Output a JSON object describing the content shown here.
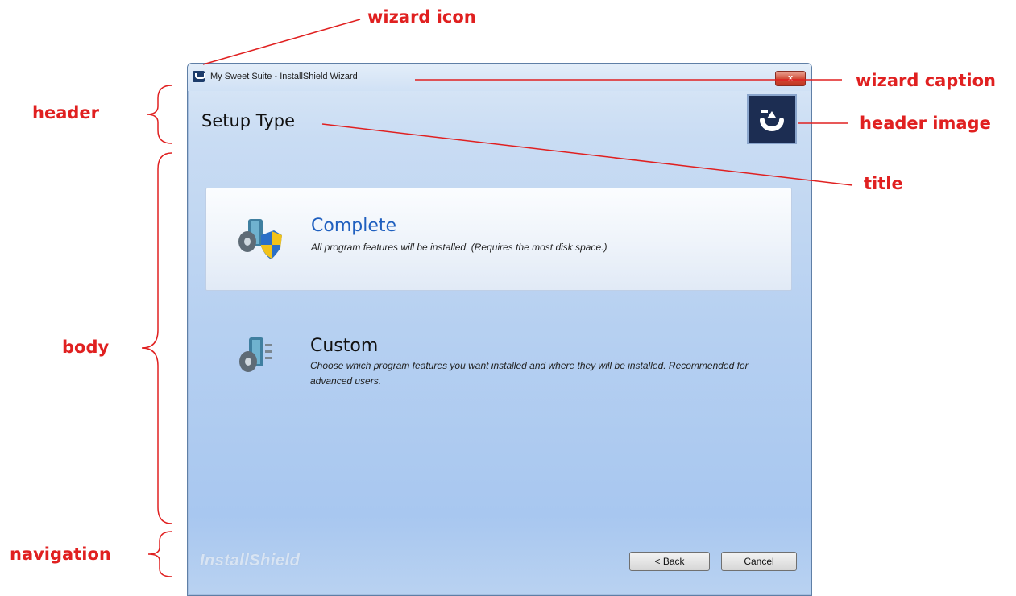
{
  "annotations": {
    "wizard_icon": "wizard icon",
    "wizard_caption": "wizard caption",
    "header": "header",
    "header_image": "header image",
    "title": "title",
    "body": "body",
    "navigation": "navigation",
    "color": "#e02020"
  },
  "window": {
    "caption": "My Sweet Suite - InstallShield Wizard",
    "close_label": "x",
    "title": "Setup Type",
    "brand": "InstallShield"
  },
  "options": [
    {
      "title": "Complete",
      "description": "All program features will be installed. (Requires the most disk space.)",
      "selected": true,
      "icon": "computer-disk-shield-icon"
    },
    {
      "title": "Custom",
      "description": "Choose which program features you want installed and where they will be installed. Recommended for advanced users.",
      "selected": false,
      "icon": "computer-disk-icon"
    }
  ],
  "navigation": {
    "back_label": "< Back",
    "cancel_label": "Cancel"
  },
  "colors": {
    "link": "#1f5fbf",
    "header_image_bg": "#1c2d52",
    "close_button": "#c1331f"
  }
}
